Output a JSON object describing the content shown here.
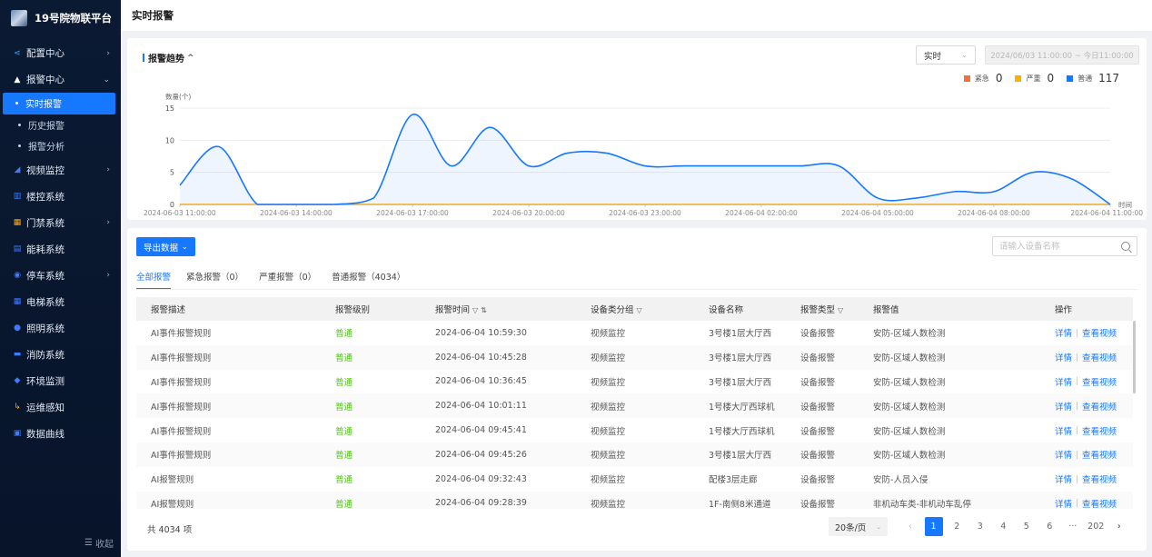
{
  "app": {
    "title": "19号院物联平台"
  },
  "page": {
    "title": "实时报警"
  },
  "sidebar": {
    "collapse_label": "收起",
    "items": [
      {
        "label": "配置中心",
        "icon": "share-icon",
        "has_children": true,
        "expanded": false
      },
      {
        "label": "报警中心",
        "icon": "alarm-icon",
        "has_children": true,
        "expanded": true,
        "children": [
          {
            "label": "实时报警",
            "active": true
          },
          {
            "label": "历史报警"
          },
          {
            "label": "报警分析"
          }
        ]
      },
      {
        "label": "视频监控",
        "icon": "camera-icon",
        "has_children": true
      },
      {
        "label": "楼控系统",
        "icon": "building-icon",
        "has_children": false
      },
      {
        "label": "门禁系统",
        "icon": "door-icon",
        "has_children": true
      },
      {
        "label": "能耗系统",
        "icon": "energy-icon",
        "has_children": false
      },
      {
        "label": "停车系统",
        "icon": "parking-icon",
        "has_children": true
      },
      {
        "label": "电梯系统",
        "icon": "elevator-icon",
        "has_children": false
      },
      {
        "label": "照明系统",
        "icon": "bulb-icon",
        "has_children": false
      },
      {
        "label": "消防系统",
        "icon": "fire-icon",
        "has_children": false
      },
      {
        "label": "环境监测",
        "icon": "environment-icon",
        "has_children": false
      },
      {
        "label": "运维感知",
        "icon": "ops-icon",
        "has_children": false
      },
      {
        "label": "数据曲线",
        "icon": "curve-icon",
        "has_children": false
      }
    ]
  },
  "trend": {
    "title": "报警趋势",
    "select_value": "实时",
    "range_value": "2024/06/03 11:00:00 ~ 今日11:00:00",
    "legend": [
      {
        "label": "紧急",
        "value": "0",
        "color": "#f5713b"
      },
      {
        "label": "严重",
        "value": "0",
        "color": "#fbb000"
      },
      {
        "label": "普通",
        "value": "117",
        "color": "#1677ff"
      }
    ]
  },
  "chart_data": {
    "type": "area",
    "ylabel": "数量(个)",
    "xlabel": "时间",
    "ylim": [
      0,
      15
    ],
    "yticks": [
      0,
      5,
      10,
      15
    ],
    "x_ticks": [
      "2024-06-03 11:00:00",
      "2024-06-03 14:00:00",
      "2024-06-03 17:00:00",
      "2024-06-03 20:00:00",
      "2024-06-03 23:00:00",
      "2024-06-04 02:00:00",
      "2024-06-04 05:00:00",
      "2024-06-04 08:00:00",
      "2024-06-04 11:00:00"
    ],
    "grid": true,
    "series": [
      {
        "name": "普通",
        "color": "#1677ff",
        "x": [
          "2024-06-03 11:00",
          "2024-06-03 12:00",
          "2024-06-03 13:00",
          "2024-06-03 14:00",
          "2024-06-03 15:00",
          "2024-06-03 16:00",
          "2024-06-03 17:00",
          "2024-06-03 18:00",
          "2024-06-03 19:00",
          "2024-06-03 20:00",
          "2024-06-03 21:00",
          "2024-06-03 22:00",
          "2024-06-03 23:00",
          "2024-06-04 00:00",
          "2024-06-04 01:00",
          "2024-06-04 02:00",
          "2024-06-04 03:00",
          "2024-06-04 04:00",
          "2024-06-04 05:00",
          "2024-06-04 06:00",
          "2024-06-04 07:00",
          "2024-06-04 08:00",
          "2024-06-04 09:00",
          "2024-06-04 10:00",
          "2024-06-04 11:00"
        ],
        "values": [
          3,
          9,
          0,
          0,
          0,
          1,
          14,
          6,
          12,
          6,
          8,
          8,
          6,
          6,
          6,
          6,
          6,
          6,
          1,
          1,
          2,
          2,
          5,
          4,
          0
        ]
      },
      {
        "name": "紧急",
        "color": "#f5713b",
        "x": [
          "2024-06-03 11:00",
          "2024-06-04 11:00"
        ],
        "values": [
          0,
          0
        ]
      },
      {
        "name": "严重",
        "color": "#fbb000",
        "x": [
          "2024-06-03 11:00",
          "2024-06-04 11:00"
        ],
        "values": [
          0,
          0
        ]
      }
    ]
  },
  "toolbar": {
    "export_label": "导出数据",
    "search_placeholder": "请输入设备名称"
  },
  "tabs": [
    {
      "label": "全部报警",
      "active": true
    },
    {
      "label": "紧急报警（0）"
    },
    {
      "label": "严重报警（0）"
    },
    {
      "label": "普通报警（4034）"
    }
  ],
  "table": {
    "columns": [
      "报警描述",
      "报警级别",
      "报警时间",
      "设备类分组",
      "设备名称",
      "报警类型",
      "报警值",
      "操作"
    ],
    "detail_label": "详情",
    "video_label": "查看视频",
    "rows": [
      [
        "AI事件报警规则",
        "普通",
        "2024-06-04 10:59:30",
        "视频监控",
        "3号楼1层大厅西",
        "设备报警",
        "安防-区域人数检测"
      ],
      [
        "AI事件报警规则",
        "普通",
        "2024-06-04 10:45:28",
        "视频监控",
        "3号楼1层大厅西",
        "设备报警",
        "安防-区域人数检测"
      ],
      [
        "AI事件报警规则",
        "普通",
        "2024-06-04 10:36:45",
        "视频监控",
        "3号楼1层大厅西",
        "设备报警",
        "安防-区域人数检测"
      ],
      [
        "AI事件报警规则",
        "普通",
        "2024-06-04 10:01:11",
        "视频监控",
        "1号楼大厅西球机",
        "设备报警",
        "安防-区域人数检测"
      ],
      [
        "AI事件报警规则",
        "普通",
        "2024-06-04 09:45:41",
        "视频监控",
        "1号楼大厅西球机",
        "设备报警",
        "安防-区域人数检测"
      ],
      [
        "AI事件报警规则",
        "普通",
        "2024-06-04 09:45:26",
        "视频监控",
        "3号楼1层大厅西",
        "设备报警",
        "安防-区域人数检测"
      ],
      [
        "AI报警规则",
        "普通",
        "2024-06-04 09:32:43",
        "视频监控",
        "配楼3层走廊",
        "设备报警",
        "安防-人员入侵"
      ],
      [
        "AI报警规则",
        "普通",
        "2024-06-04 09:28:39",
        "视频监控",
        "1F-南侧8米通道",
        "设备报警",
        "非机动车类-非机动车乱停"
      ]
    ]
  },
  "pagination": {
    "total_label": "共 4034 项",
    "page_size": "20条/页",
    "pages": [
      "1",
      "2",
      "3",
      "4",
      "5",
      "6"
    ],
    "ellipsis": "···",
    "last_page": "202",
    "current": "1"
  }
}
